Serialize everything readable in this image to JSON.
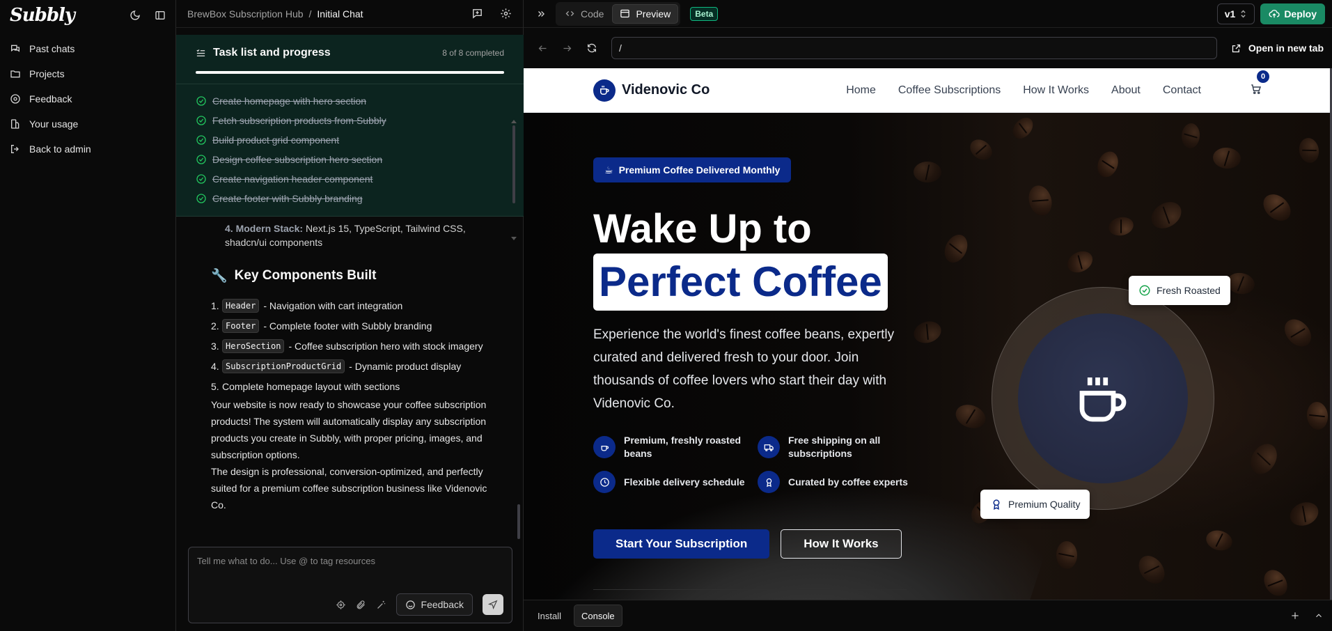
{
  "sidebar": {
    "logo": "Subbly",
    "items": [
      {
        "label": "Past chats",
        "icon": "chat-history-icon"
      },
      {
        "label": "Projects",
        "icon": "folder-icon"
      },
      {
        "label": "Feedback",
        "icon": "feedback-icon"
      },
      {
        "label": "Your usage",
        "icon": "usage-icon"
      },
      {
        "label": "Back to admin",
        "icon": "logout-icon"
      }
    ]
  },
  "chat": {
    "breadcrumb": {
      "project": "BrewBox Subscription Hub",
      "separator": "/",
      "current": "Initial Chat"
    },
    "tasks": {
      "title": "Task list and progress",
      "count": "8 of 8 completed",
      "progress": 1.0,
      "items": [
        "Create homepage with hero section",
        "Fetch subscription products from Subbly",
        "Build product grid component",
        "Design coffee subscription hero section",
        "Create navigation header component",
        "Create footer with Subbly branding"
      ]
    },
    "message": {
      "stack_number": "4.",
      "stack_label": "Modern Stack:",
      "stack_text": "Next.js 15, TypeScript, Tailwind CSS, shadcn/ui components",
      "heading_emoji": "🔧",
      "heading": "Key Components Built",
      "components": [
        {
          "num": "1.",
          "code": "Header",
          "text": "- Navigation with cart integration"
        },
        {
          "num": "2.",
          "code": "Footer",
          "text": "- Complete footer with Subbly branding"
        },
        {
          "num": "3.",
          "code": "HeroSection",
          "text": "- Coffee subscription hero with stock imagery"
        },
        {
          "num": "4.",
          "code": "SubscriptionProductGrid",
          "text": "- Dynamic product display"
        },
        {
          "num": "5.",
          "code": "",
          "text": "Complete homepage layout with sections"
        }
      ],
      "para1": "Your website is now ready to showcase your coffee subscription products! The system will automatically display any subscription products you create in Subbly, with proper pricing, images, and subscription options.",
      "para2": "The design is professional, conversion-optimized, and perfectly suited for a premium coffee subscription business like Videnovic Co."
    },
    "composer": {
      "placeholder": "Tell me what to do... Use @ to tag resources",
      "feedback_label": "Feedback"
    }
  },
  "preview": {
    "tabs": {
      "code": "Code",
      "preview": "Preview"
    },
    "beta": "Beta",
    "version": "v1",
    "deploy": "Deploy",
    "url": "/",
    "open_new_tab": "Open in new tab",
    "bottom_tabs": {
      "install": "Install",
      "console": "Console"
    }
  },
  "site": {
    "brand": "Videnovic Co",
    "nav": [
      "Home",
      "Coffee Subscriptions",
      "How It Works",
      "About",
      "Contact"
    ],
    "cart_count": "0",
    "pill_emoji": "☕",
    "pill": "Premium Coffee Delivered Monthly",
    "headline1": "Wake Up to",
    "headline2": "Perfect Coffee",
    "lead": "Experience the world's finest coffee beans, expertly curated and delivered fresh to your door. Join thousands of coffee lovers who start their day with Videnovic Co.",
    "features": [
      {
        "text": "Premium, freshly roasted beans",
        "icon": "coffee-icon"
      },
      {
        "text": "Free shipping on all subscriptions",
        "icon": "truck-icon"
      },
      {
        "text": "Flexible delivery schedule",
        "icon": "clock-icon"
      },
      {
        "text": "Curated by coffee experts",
        "icon": "award-icon"
      }
    ],
    "cta_primary": "Start Your Subscription",
    "cta_secondary": "How It Works",
    "badge_fresh": "Fresh Roasted",
    "badge_quality": "Premium Quality"
  },
  "colors": {
    "brand_blue": "#0b2a8a",
    "deploy_green": "#1a8a64",
    "task_bg": "#0c241f",
    "check_green": "#22c55e"
  }
}
